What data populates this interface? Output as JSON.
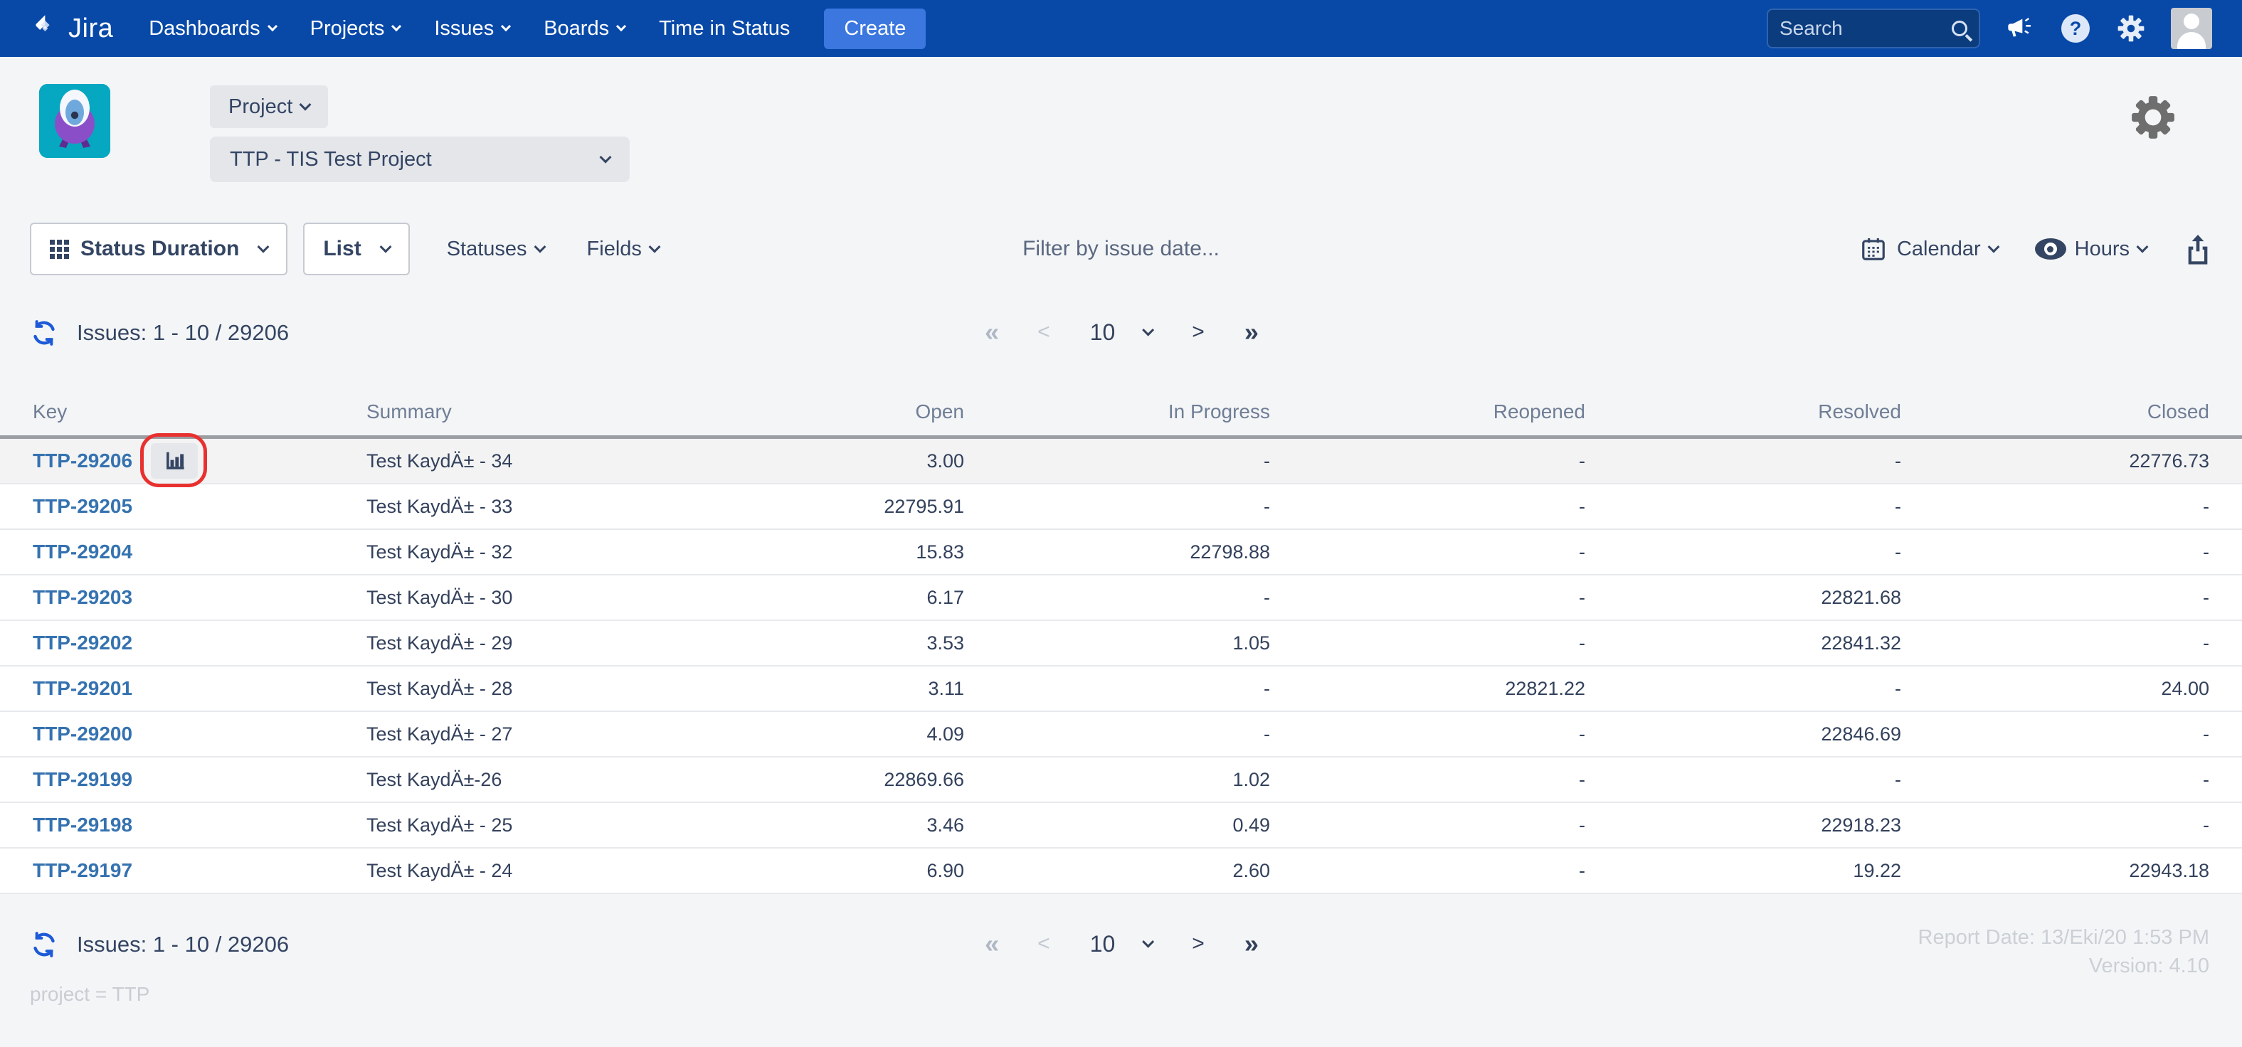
{
  "navbar": {
    "brand": "Jira",
    "items": [
      {
        "label": "Dashboards",
        "caret": true
      },
      {
        "label": "Projects",
        "caret": true
      },
      {
        "label": "Issues",
        "caret": true
      },
      {
        "label": "Boards",
        "caret": true
      },
      {
        "label": "Time in Status",
        "caret": false
      }
    ],
    "create_label": "Create",
    "search_placeholder": "Search"
  },
  "project_header": {
    "scope_button": "Project",
    "project_name": "TTP - TIS Test Project"
  },
  "toolbar": {
    "report_type": "Status Duration",
    "view_mode": "List",
    "statuses": "Statuses",
    "fields": "Fields",
    "filter_placeholder": "Filter by issue date...",
    "calendar": "Calendar",
    "units": "Hours"
  },
  "pagination": {
    "issues_label": "Issues: 1 - 10 / 29206",
    "first": "«",
    "prev": "<",
    "page_size": "10",
    "next": ">",
    "last": "»"
  },
  "table": {
    "columns": [
      "Key",
      "Summary",
      "Open",
      "In Progress",
      "Reopened",
      "Resolved",
      "Closed"
    ],
    "rows": [
      {
        "key": "TTP-29206",
        "summary": "Test KaydÄ± - 34",
        "open": "3.00",
        "in_progress": "-",
        "reopened": "-",
        "resolved": "-",
        "closed": "22776.73",
        "highlighted": true,
        "chart_button": true
      },
      {
        "key": "TTP-29205",
        "summary": "Test KaydÄ± - 33",
        "open": "22795.91",
        "in_progress": "-",
        "reopened": "-",
        "resolved": "-",
        "closed": "-"
      },
      {
        "key": "TTP-29204",
        "summary": "Test KaydÄ± - 32",
        "open": "15.83",
        "in_progress": "22798.88",
        "reopened": "-",
        "resolved": "-",
        "closed": "-"
      },
      {
        "key": "TTP-29203",
        "summary": "Test KaydÄ± - 30",
        "open": "6.17",
        "in_progress": "-",
        "reopened": "-",
        "resolved": "22821.68",
        "closed": "-"
      },
      {
        "key": "TTP-29202",
        "summary": "Test KaydÄ± - 29",
        "open": "3.53",
        "in_progress": "1.05",
        "reopened": "-",
        "resolved": "22841.32",
        "closed": "-"
      },
      {
        "key": "TTP-29201",
        "summary": "Test KaydÄ± - 28",
        "open": "3.11",
        "in_progress": "-",
        "reopened": "22821.22",
        "resolved": "-",
        "closed": "24.00"
      },
      {
        "key": "TTP-29200",
        "summary": "Test KaydÄ± - 27",
        "open": "4.09",
        "in_progress": "-",
        "reopened": "-",
        "resolved": "22846.69",
        "closed": "-"
      },
      {
        "key": "TTP-29199",
        "summary": "Test KaydÄ±-26",
        "open": "22869.66",
        "in_progress": "1.02",
        "reopened": "-",
        "resolved": "-",
        "closed": "-"
      },
      {
        "key": "TTP-29198",
        "summary": "Test KaydÄ± - 25",
        "open": "3.46",
        "in_progress": "0.49",
        "reopened": "-",
        "resolved": "22918.23",
        "closed": "-"
      },
      {
        "key": "TTP-29197",
        "summary": "Test KaydÄ± - 24",
        "open": "6.90",
        "in_progress": "2.60",
        "reopened": "-",
        "resolved": "19.22",
        "closed": "22943.18"
      }
    ]
  },
  "footer": {
    "report_date": "Report Date: 13/Eki/20 1:53 PM",
    "version": "Version: 4.10",
    "jql": "project = TTP"
  },
  "colors": {
    "navbar_blue": "#0849A8",
    "create_blue": "#3B77DF",
    "link_blue": "#3572B0",
    "app_logo_teal": "#06A7C0",
    "annotation_red": "#E8312F",
    "page_bg": "#F4F5F7"
  }
}
